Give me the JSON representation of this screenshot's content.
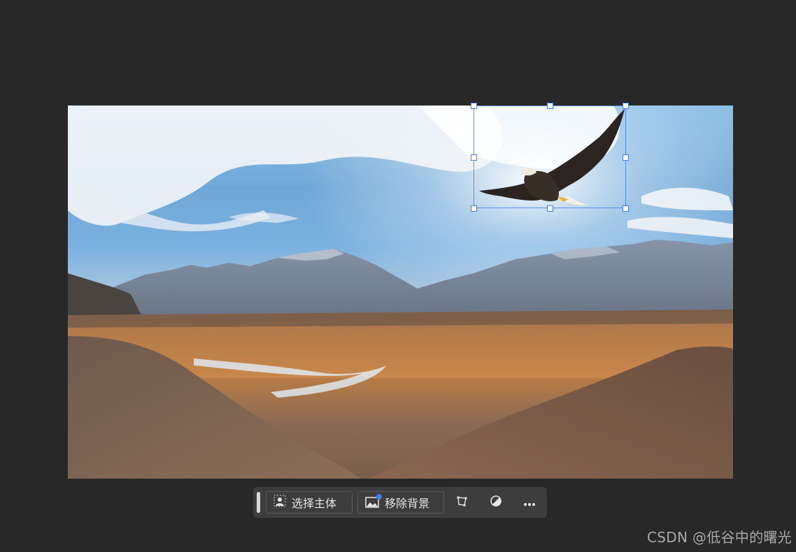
{
  "canvas": {
    "image_subject": "eagle-over-mountain-valley",
    "selection": "eagle-layer"
  },
  "toolbar": {
    "select_subject_label": "选择主体",
    "select_subject_icon": "person-select-icon",
    "remove_bg_label": "移除背景",
    "remove_bg_icon": "image-remove-bg-icon",
    "transform_icon": "transform-icon",
    "adjust_icon": "contrast-icon",
    "more_icon": "more-icon"
  },
  "watermark": "CSDN @低谷中的曙光",
  "colors": {
    "background": "#282828",
    "toolbar": "#3d3d3d",
    "selection": "#5a8dff",
    "badge": "#3b82f6"
  }
}
